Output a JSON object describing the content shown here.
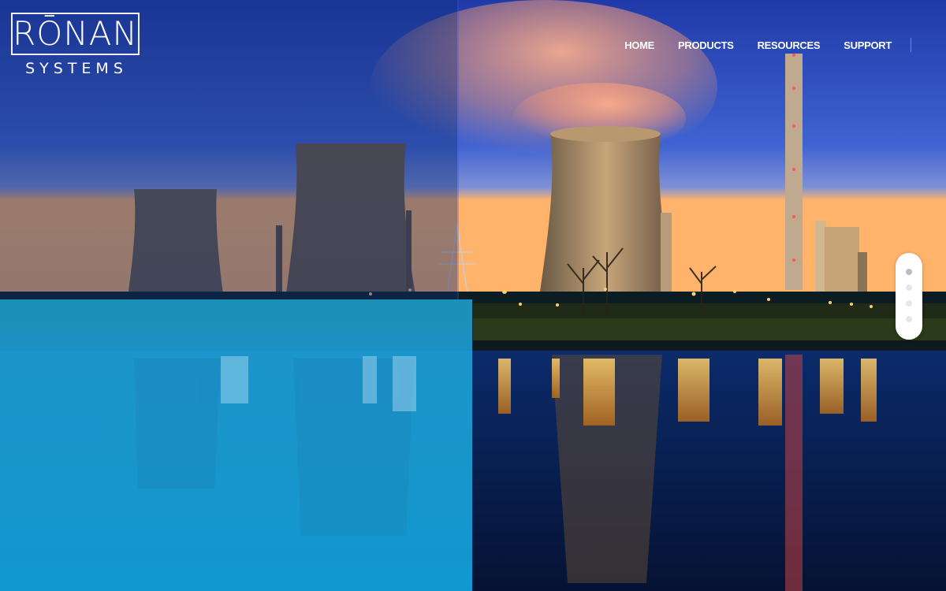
{
  "brand": {
    "name": "RŌNAN",
    "tagline": "SYSTEMS"
  },
  "nav": {
    "items": [
      {
        "label": "HOME"
      },
      {
        "label": "PRODUCTS"
      },
      {
        "label": "RESOURCES"
      },
      {
        "label": "SUPPORT"
      }
    ]
  },
  "hero": {
    "image": "nuclear-power-plant-at-dusk",
    "overlay_color": "#1aa6d9"
  },
  "slider": {
    "slide_count": 4,
    "active_index": 0
  }
}
